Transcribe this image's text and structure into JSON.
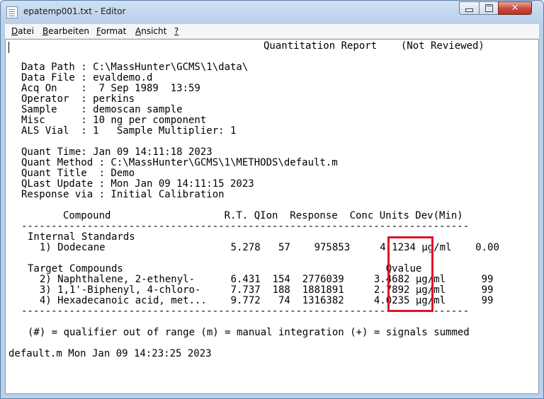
{
  "window": {
    "title": "epatemp001.txt - Editor",
    "controls": {
      "minimize": "minimize",
      "maximize": "maximize",
      "close": "✕"
    }
  },
  "menu": {
    "items": [
      "Datei",
      "Bearbeiten",
      "Format",
      "Ansicht",
      "?"
    ],
    "access_keys": [
      "D",
      "B",
      "F",
      "A",
      "?"
    ]
  },
  "report": {
    "header": "Quantitation Report    (Not Reviewed)",
    "data_path": "Data Path : C:\\MassHunter\\GCMS\\1\\data\\",
    "data_file": "Data File : evaldemo.d",
    "acq_on": "Acq On    :  7 Sep 1989  13:59",
    "operator": "Operator  : perkins",
    "sample": "Sample    : demoscan sample",
    "misc": "Misc      : 10 ng per component",
    "als_vial": "ALS Vial  : 1   Sample Multiplier: 1",
    "quant_time": "Quant Time: Jan 09 14:11:18 2023",
    "quant_method": "Quant Method : C:\\MassHunter\\GCMS\\1\\METHODS\\default.m",
    "quant_title": "Quant Title  : Demo",
    "qlast_update": "QLast Update : Mon Jan 09 14:11:15 2023",
    "response_via": "Response via : Initial Calibration",
    "column_header": "       Compound                   R.T. QIon  Response  Conc Units Dev(Min)",
    "divider": "---------------------------------------------------------------------------",
    "internal_standards_heading": "Internal Standards",
    "internal_rows": [
      "  1) Dodecane                     5.278   57    975853     4.1234 µg/ml    0.00"
    ],
    "target_heading": "Target Compounds                                            Qvalue",
    "target_rows": [
      "  2) Naphthalene, 2-ethenyl-      6.431  154  2776039     3.4682 µg/ml      99",
      "  3) 1,1'-Biphenyl, 4-chloro-     7.737  188  1881891     2.7892 µg/ml      99",
      "  4) Hexadecanoic acid, met...    9.772   74  1316382     4.0235 µg/ml      99"
    ],
    "legend": "(#) = qualifier out of range (m) = manual integration (+) = signals summed",
    "footer": "default.m Mon Jan 09 14:23:25 2023"
  },
  "colors": {
    "highlight_box": "#e0142a",
    "close_button": "#c9493a"
  }
}
